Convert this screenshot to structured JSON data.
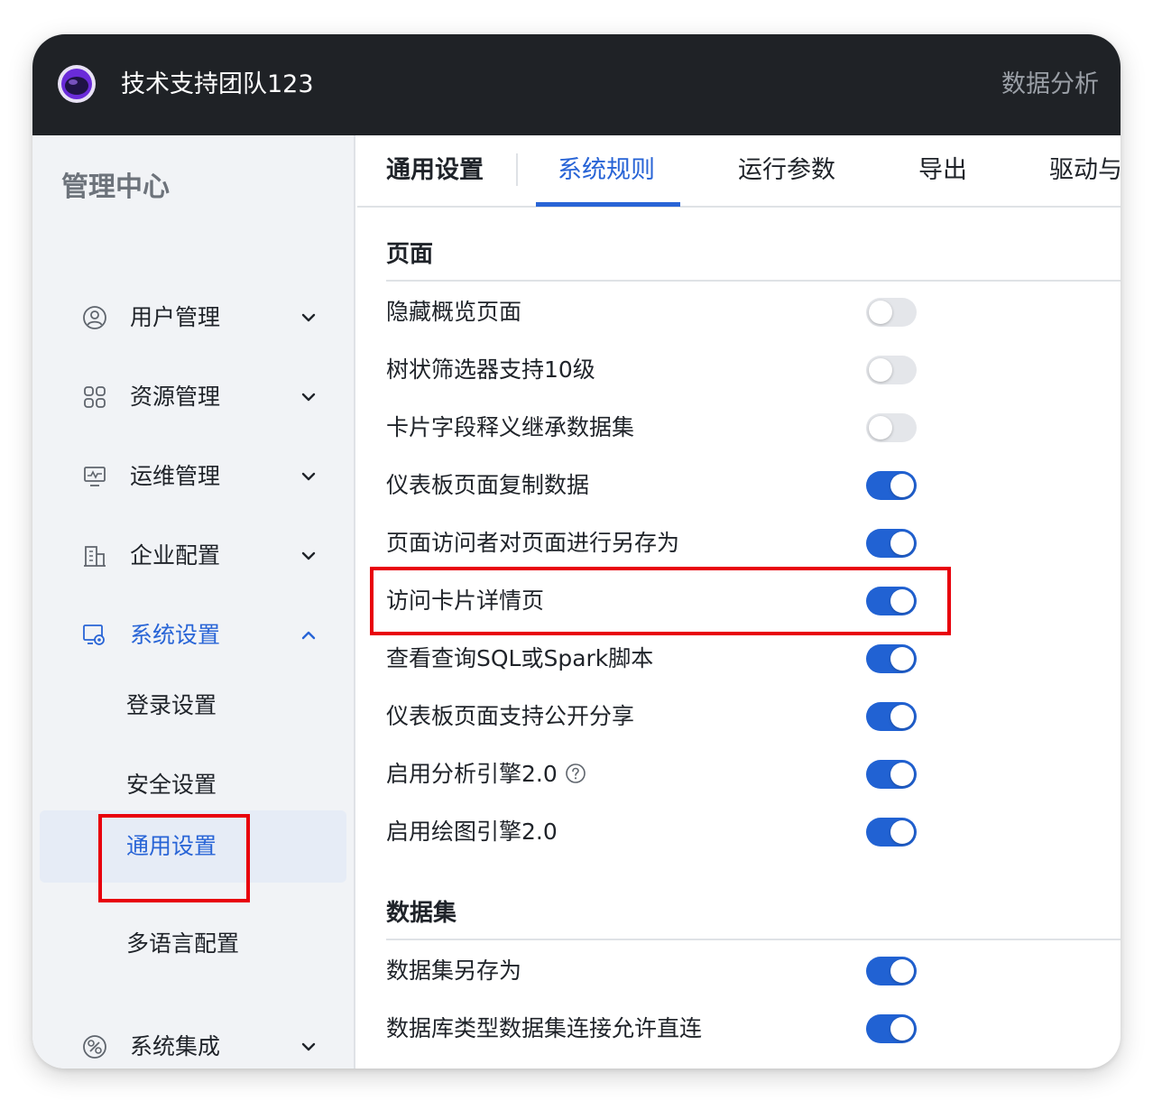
{
  "header": {
    "team_name": "技术支持团队123",
    "app_link": "数据分析",
    "logo_icon": "planet-logo-icon"
  },
  "sidebar": {
    "title": "管理中心",
    "items": [
      {
        "label": "用户管理",
        "icon": "user-icon",
        "expanded": false
      },
      {
        "label": "资源管理",
        "icon": "grid-icon",
        "expanded": false
      },
      {
        "label": "运维管理",
        "icon": "monitor-icon",
        "expanded": false
      },
      {
        "label": "企业配置",
        "icon": "building-icon",
        "expanded": false
      },
      {
        "label": "系统设置",
        "icon": "gear-settings-icon",
        "expanded": true
      },
      {
        "label": "系统集成",
        "icon": "integration-icon",
        "expanded": false
      }
    ],
    "sub_items": [
      {
        "label": "登录设置"
      },
      {
        "label": "安全设置"
      },
      {
        "label": "通用设置",
        "current": true
      },
      {
        "label": "多语言配置"
      }
    ]
  },
  "tabs": [
    {
      "label": "通用设置"
    },
    {
      "label": "系统规则",
      "active": true
    },
    {
      "label": "运行参数"
    },
    {
      "label": "导出"
    },
    {
      "label": "驱动与"
    }
  ],
  "sections": [
    {
      "title": "页面",
      "rows": [
        {
          "label": "隐藏概览页面",
          "enabled": false
        },
        {
          "label": "树状筛选器支持10级",
          "enabled": false
        },
        {
          "label": "卡片字段释义继承数据集",
          "enabled": false
        },
        {
          "label": "仪表板页面复制数据",
          "enabled": true
        },
        {
          "label": "页面访问者对页面进行另存为",
          "enabled": true
        },
        {
          "label": "访问卡片详情页",
          "enabled": true,
          "highlighted": true
        },
        {
          "label": "查看查询SQL或Spark脚本",
          "enabled": true
        },
        {
          "label": "仪表板页面支持公开分享",
          "enabled": true
        },
        {
          "label": "启用分析引擎2.0",
          "enabled": true,
          "help_icon": "question-circle-icon"
        },
        {
          "label": "启用绘图引擎2.0",
          "enabled": true
        }
      ]
    },
    {
      "title": "数据集",
      "rows": [
        {
          "label": "数据集另存为",
          "enabled": true
        },
        {
          "label": "数据库类型数据集连接允许直连",
          "enabled": true
        }
      ]
    }
  ],
  "colors": {
    "accent": "#2864d6",
    "toggle_on": "#2162d3",
    "toggle_off": "#e4e6ea",
    "highlight": "#e8000b",
    "topbar": "#1f2226"
  }
}
